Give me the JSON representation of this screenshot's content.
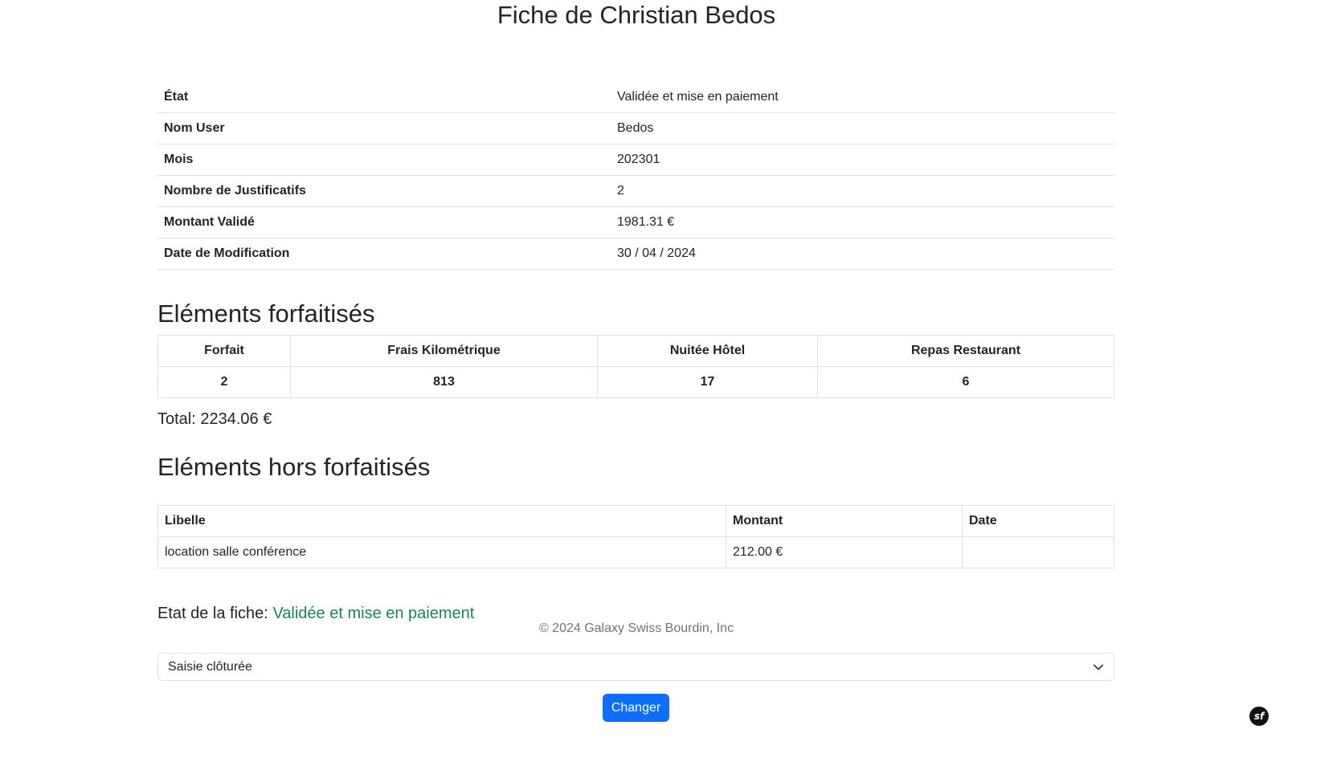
{
  "page": {
    "title": "Fiche de Christian Bedos"
  },
  "info": {
    "rows": [
      {
        "label": "État",
        "value": "Validée et mise en paiement"
      },
      {
        "label": "Nom User",
        "value": "Bedos"
      },
      {
        "label": "Mois",
        "value": "202301"
      },
      {
        "label": "Nombre de Justificatifs",
        "value": "2"
      },
      {
        "label": "Montant Validé",
        "value": "1981.31 €"
      },
      {
        "label": "Date de Modification",
        "value": "30 / 04 / 2024"
      }
    ]
  },
  "forfaitises": {
    "title": "Eléments forfaitisés",
    "headers": [
      "Forfait",
      "Frais Kilométrique",
      "Nuitée Hôtel",
      "Repas Restaurant"
    ],
    "values": [
      "2",
      "813",
      "17",
      "6"
    ],
    "total": "Total: 2234.06 €"
  },
  "hors_forfait": {
    "title": "Eléments hors forfaitisés",
    "headers": [
      "Libelle",
      "Montant",
      "Date"
    ],
    "rows": [
      {
        "libelle": "location salle conférence",
        "montant": "212.00 €",
        "date": ""
      }
    ]
  },
  "state": {
    "label": "Etat de la fiche:",
    "value": "Validée et mise en paiement",
    "value_color": "#198754"
  },
  "footer": {
    "text": "© 2024 Galaxy Swiss Bourdin, Inc"
  },
  "form": {
    "select_value": "Saisie clôturée",
    "submit_label": "Changer",
    "accent_color": "#0d6efd"
  },
  "icons": {
    "select_chevron": "chevron-down-icon",
    "debug_badge": "symfony-icon"
  }
}
